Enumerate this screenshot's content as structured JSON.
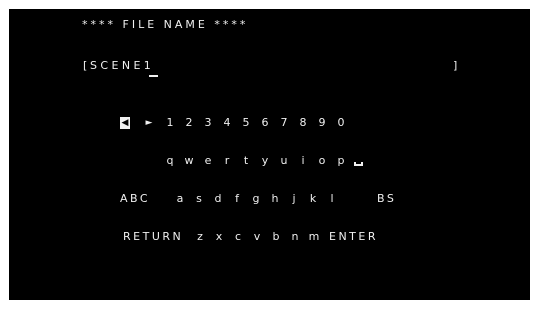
{
  "title": "**** FILE NAME ****",
  "filename": {
    "open_bracket": "[",
    "value": "SCENE1",
    "close_bracket": "]"
  },
  "keyboard": {
    "row1": [
      "◀",
      "►",
      "1",
      "2",
      "3",
      "4",
      "5",
      "6",
      "7",
      "8",
      "9",
      "0"
    ],
    "row2": [
      "q",
      "w",
      "e",
      "r",
      "t",
      "y",
      "u",
      "i",
      "o",
      "p"
    ],
    "row3": [
      "ABC",
      "a",
      "s",
      "d",
      "f",
      "g",
      "h",
      "j",
      "k",
      "l",
      "BS"
    ],
    "row4": [
      "RETURN",
      "z",
      "x",
      "c",
      "v",
      "b",
      "n",
      "m",
      "ENTER"
    ],
    "selected_key": "◀",
    "space_key_icon": "space-bar-icon"
  },
  "colors": {
    "background": "#000000",
    "text": "#f0f0f0"
  }
}
